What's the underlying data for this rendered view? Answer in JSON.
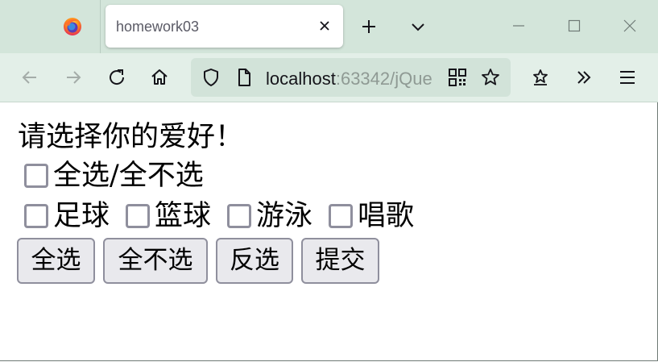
{
  "browser": {
    "tab_title": "homework03",
    "url_host": "localhost",
    "url_rest": ":63342/jQue"
  },
  "page": {
    "prompt": "请选择你的爱好！",
    "select_all_toggle": "全选/全不选",
    "hobbies": [
      {
        "label": "足球",
        "checked": false
      },
      {
        "label": "篮球",
        "checked": false
      },
      {
        "label": "游泳",
        "checked": false
      },
      {
        "label": "唱歌",
        "checked": false
      }
    ],
    "buttons": {
      "select_all": "全选",
      "select_none": "全不选",
      "invert": "反选",
      "submit": "提交"
    }
  },
  "colors": {
    "tabstrip_bg": "#d3e5da",
    "navbar_bg": "#e3efe8",
    "urlbar_bg": "#d2e3d9",
    "button_bg": "#e9e9ed"
  }
}
